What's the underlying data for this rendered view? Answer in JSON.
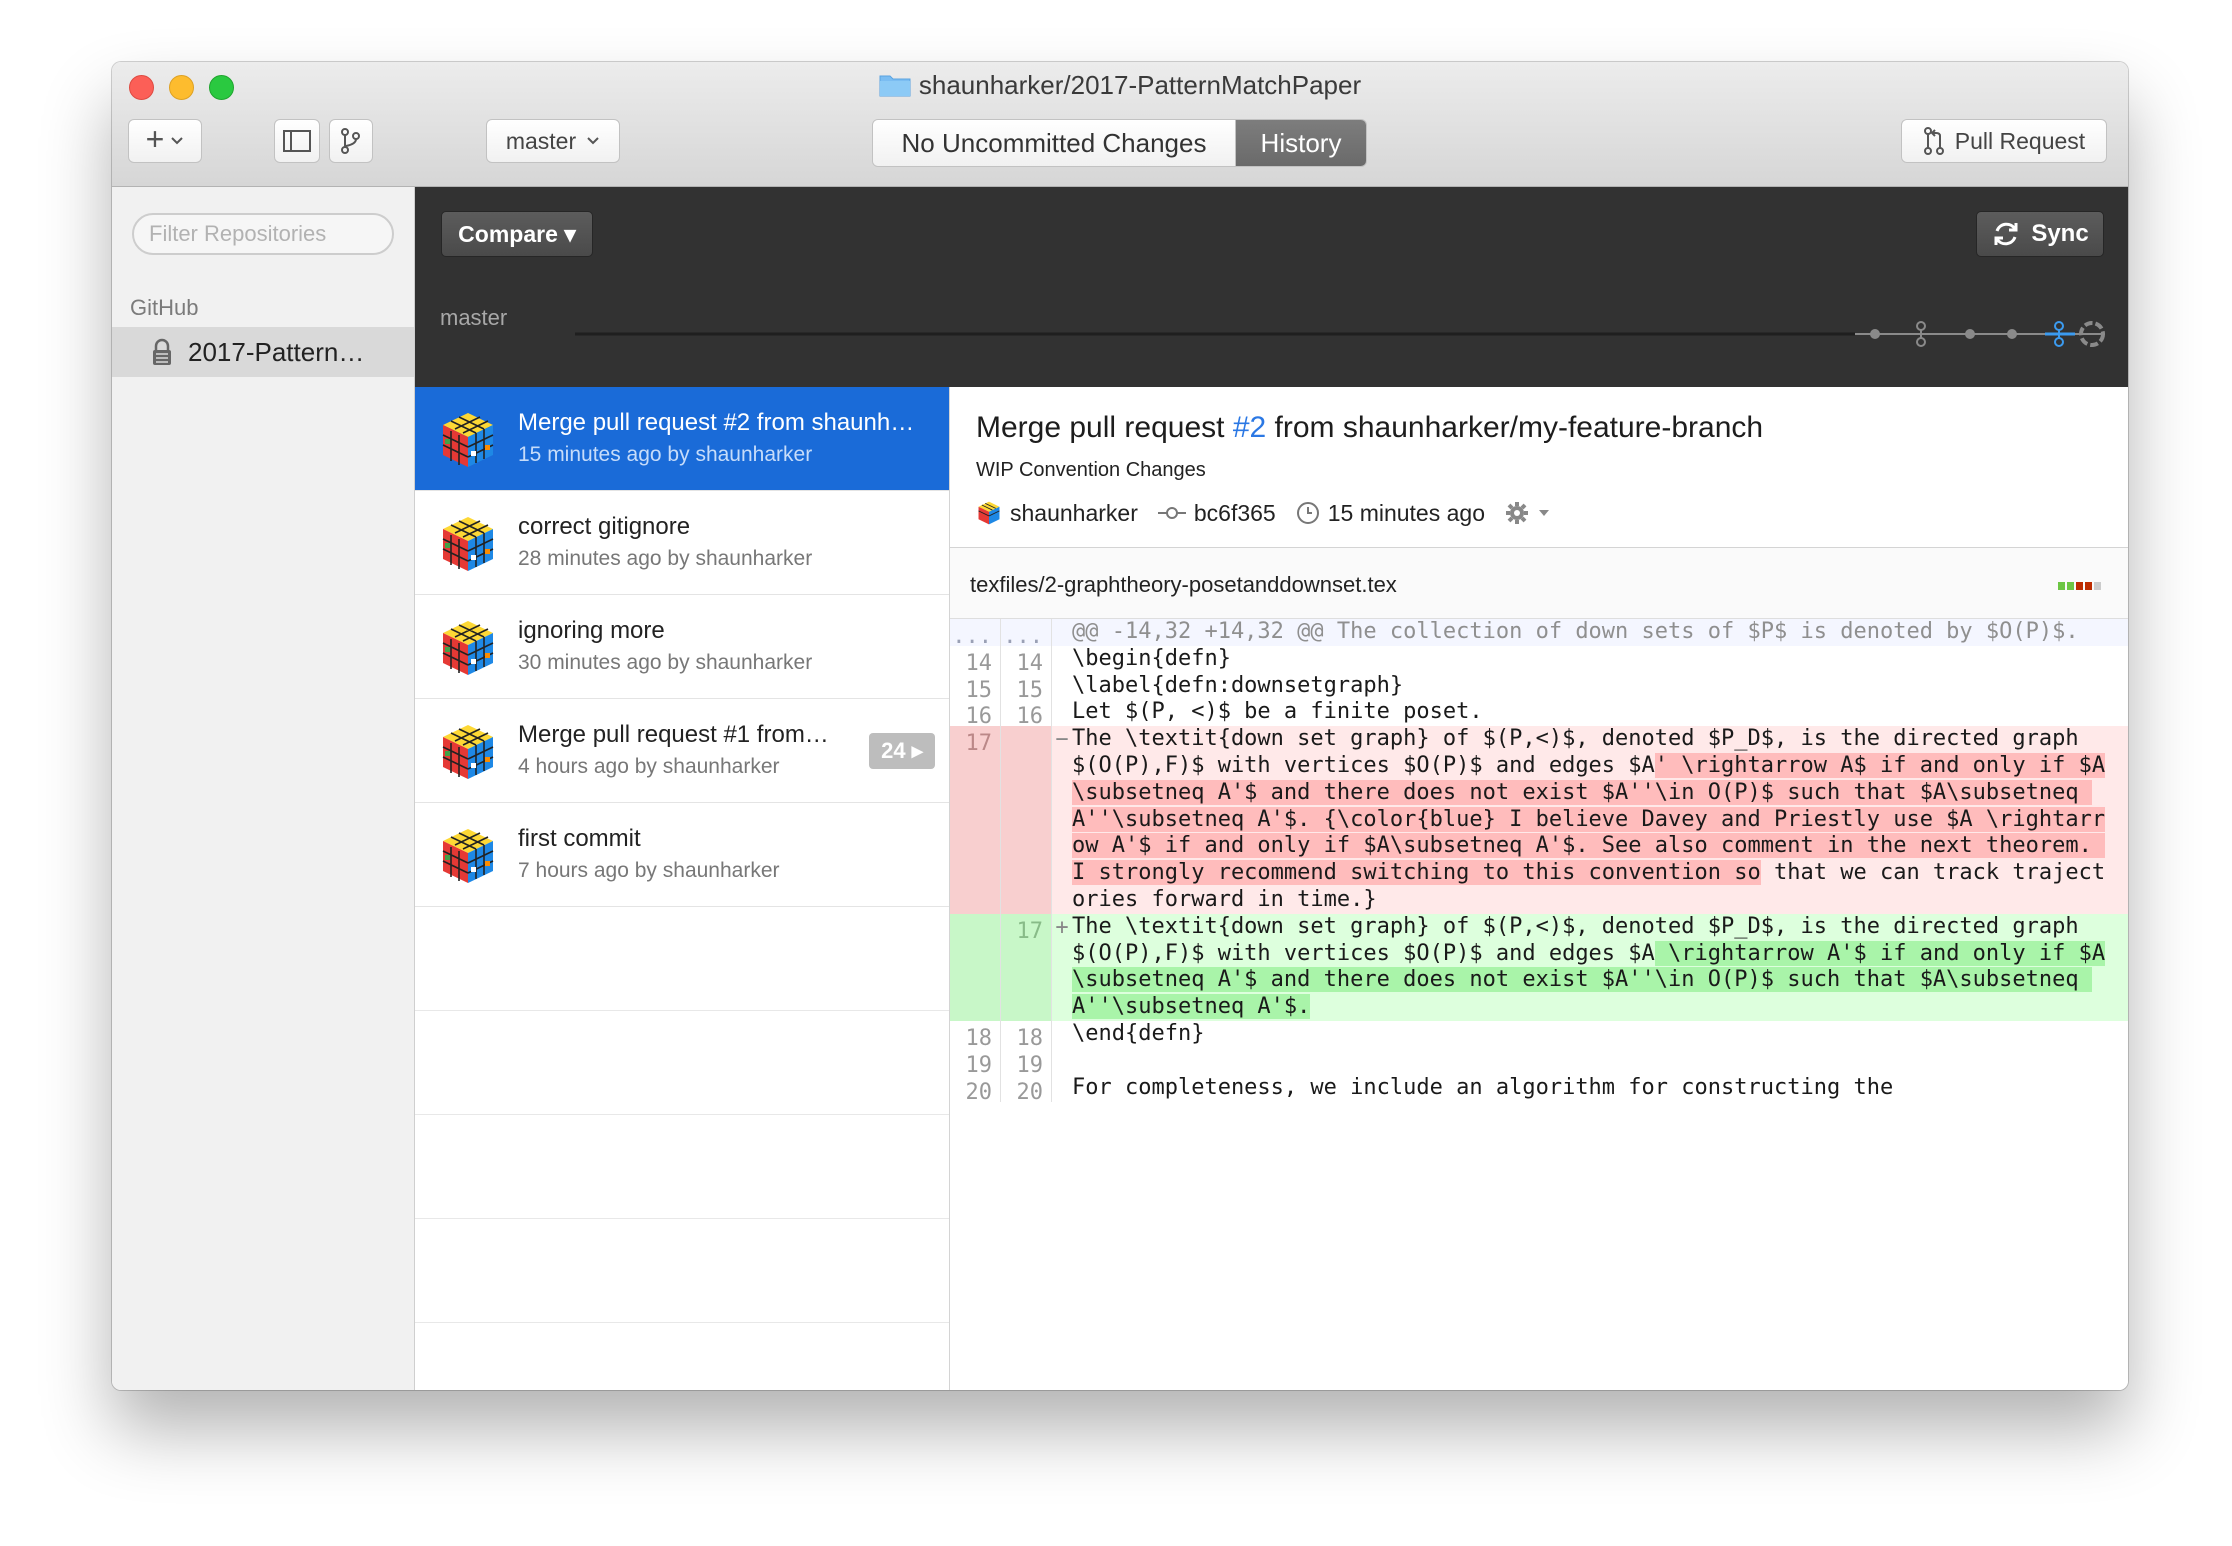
{
  "window": {
    "title": "shaunharker/2017-PatternMatchPaper"
  },
  "toolbar": {
    "add_label": "+",
    "branch_label": "master",
    "view_uncommitted": "No Uncommitted Changes",
    "view_history": "History",
    "pull_request_label": "Pull Request"
  },
  "sidebar": {
    "filter_placeholder": "Filter Repositories",
    "section": "GitHub",
    "repo": "2017-Pattern…"
  },
  "compare": {
    "compare_label": "Compare ▾",
    "sync_label": "Sync",
    "branch": "master"
  },
  "commits": [
    {
      "title": "Merge pull request #2 from shaunh…",
      "meta": "15 minutes ago by shaunharker",
      "selected": true
    },
    {
      "title": "correct gitignore",
      "meta": "28 minutes ago by shaunharker"
    },
    {
      "title": "ignoring more",
      "meta": "30 minutes ago by shaunharker"
    },
    {
      "title": "Merge pull request #1 from…",
      "meta": "4 hours ago by shaunharker",
      "badge": "24 ▸"
    },
    {
      "title": "first commit",
      "meta": "7 hours ago by shaunharker"
    }
  ],
  "detail": {
    "title_pre": "Merge pull request ",
    "title_num": "#2",
    "title_post": " from shaunharker/my-feature-branch",
    "subtitle": "WIP Convention Changes",
    "author": "shaunharker",
    "sha": "bc6f365",
    "time": "15 minutes ago",
    "file": "texfiles/2-graphtheory-posetanddownset.tex"
  },
  "diff": {
    "hunk": {
      "n1": "...",
      "n2": "...",
      "text": "@@ -14,32 +14,32 @@ The collection of down sets of $P$ is denoted by $O(P)$."
    },
    "ctx1": [
      {
        "n1": "14",
        "n2": "14",
        "text": "\\begin{defn}"
      },
      {
        "n1": "15",
        "n2": "15",
        "text": "\\label{defn:downsetgraph}"
      },
      {
        "n1": "16",
        "n2": "16",
        "text": "Let $(P, <)$ be a finite poset."
      }
    ],
    "del": {
      "n1": "17",
      "sign": "−",
      "pre": "The \\textit{down set graph} of $(P,<)$, denoted $P_D$, is the directed graph $(O(P),F)$ with vertices $O(P)$ and edges $A",
      "hl": "' \\rightarrow A$ if and only if $A\\subsetneq A'$ and there does not exist $A''\\in O(P)$ such that $A\\subsetneq A''\\subsetneq A'$. {\\color{blue} I believe Davey and Priestly use $A \\rightarrow A'$ if and only if $A\\subsetneq A'$. See also comment in the next theorem. I strongly recommend switching to this convention so",
      "post": " that we can track trajectories forward in time.}"
    },
    "add": {
      "n2": "17",
      "sign": "+",
      "pre": "The \\textit{down set graph} of $(P,<)$, denoted $P_D$, is the directed graph $(O(P),F)$ with vertices $O(P)$ and edges $A",
      "hl": " \\rightarrow A'$ if and only if $A\\subsetneq A'$ and there does not exist $A''\\in O(P)$ such that $A\\subsetneq A''\\subsetneq A'$.",
      "post": ""
    },
    "ctx2": [
      {
        "n1": "18",
        "n2": "18",
        "text": "\\end{defn}"
      },
      {
        "n1": "19",
        "n2": "19",
        "text": ""
      },
      {
        "n1": "20",
        "n2": "20",
        "text": "For completeness, we include an algorithm for constructing the"
      }
    ]
  },
  "colors": {
    "selection": "#1a6bd8",
    "link": "#2b78e4",
    "deleted_bg": "#ffe9e9",
    "deleted_hl": "#ffbcbc",
    "added_bg": "#ddffdd",
    "added_hl": "#a9f4a9"
  }
}
